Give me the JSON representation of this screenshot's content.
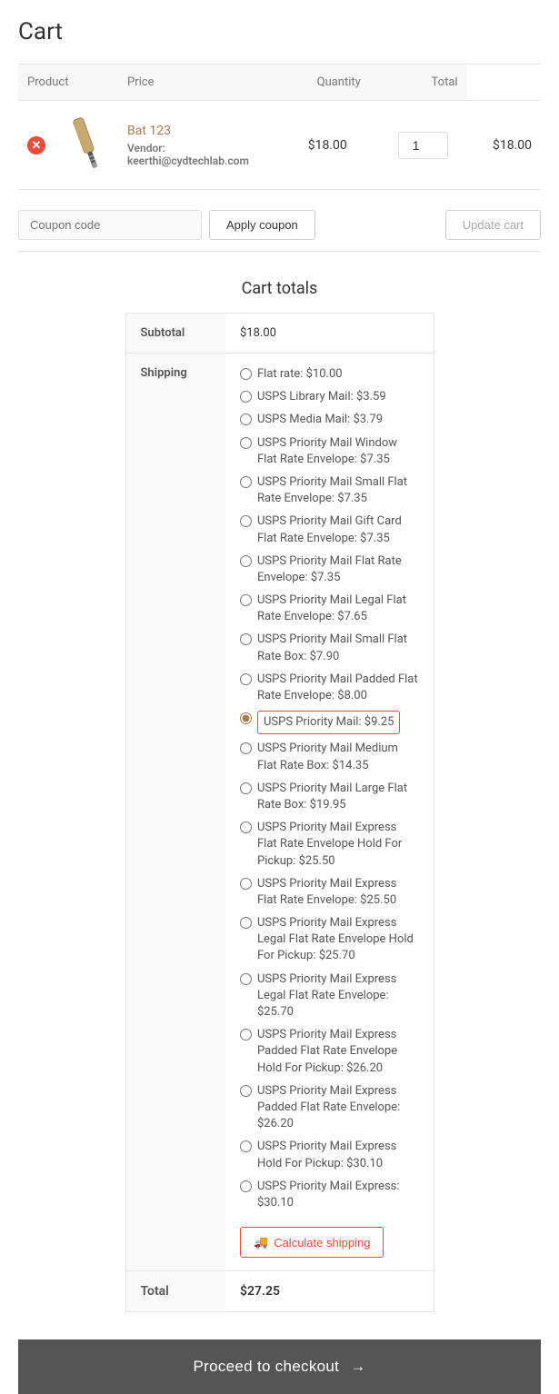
{
  "page": {
    "title": "Cart"
  },
  "table": {
    "headers": {
      "product": "Product",
      "price": "Price",
      "quantity": "Quantity",
      "total": "Total"
    }
  },
  "cart_item": {
    "product_name": "Bat 123",
    "vendor_label": "Vendor:",
    "vendor_email": "keerthi@cydtechlab.com",
    "price": "$18.00",
    "quantity": 1,
    "total": "$18.00"
  },
  "coupon": {
    "placeholder": "Coupon code",
    "apply_label": "Apply coupon",
    "update_label": "Update cart"
  },
  "cart_totals": {
    "title": "Cart totals",
    "subtotal_label": "Subtotal",
    "subtotal_value": "$18.00",
    "shipping_label": "Shipping",
    "total_label": "Total",
    "total_value": "$27.25"
  },
  "shipping_options": [
    {
      "id": "opt1",
      "label": "Flat rate: $10.00",
      "selected": false
    },
    {
      "id": "opt2",
      "label": "USPS Library Mail: $3.59",
      "selected": false
    },
    {
      "id": "opt3",
      "label": "USPS Media Mail: $3.79",
      "selected": false
    },
    {
      "id": "opt4",
      "label": "USPS Priority Mail Window Flat Rate Envelope: $7.35",
      "selected": false
    },
    {
      "id": "opt5",
      "label": "USPS Priority Mail Small Flat Rate Envelope: $7.35",
      "selected": false
    },
    {
      "id": "opt6",
      "label": "USPS Priority Mail Gift Card Flat Rate Envelope: $7.35",
      "selected": false
    },
    {
      "id": "opt7",
      "label": "USPS Priority Mail Flat Rate Envelope: $7.35",
      "selected": false
    },
    {
      "id": "opt8",
      "label": "USPS Priority Mail Legal Flat Rate Envelope: $7.65",
      "selected": false
    },
    {
      "id": "opt9",
      "label": "USPS Priority Mail Small Flat Rate Box: $7.90",
      "selected": false
    },
    {
      "id": "opt10",
      "label": "USPS Priority Mail Padded Flat Rate Envelope: $8.00",
      "selected": false
    },
    {
      "id": "opt11",
      "label": "USPS Priority Mail: $9.25",
      "selected": true
    },
    {
      "id": "opt12",
      "label": "USPS Priority Mail Medium Flat Rate Box: $14.35",
      "selected": false
    },
    {
      "id": "opt13",
      "label": "USPS Priority Mail Large Flat Rate Box: $19.95",
      "selected": false
    },
    {
      "id": "opt14",
      "label": "USPS Priority Mail Express Flat Rate Envelope Hold For Pickup: $25.50",
      "selected": false
    },
    {
      "id": "opt15",
      "label": "USPS Priority Mail Express Flat Rate Envelope: $25.50",
      "selected": false
    },
    {
      "id": "opt16",
      "label": "USPS Priority Mail Express Legal Flat Rate Envelope Hold For Pickup: $25.70",
      "selected": false
    },
    {
      "id": "opt17",
      "label": "USPS Priority Mail Express Legal Flat Rate Envelope: $25.70",
      "selected": false
    },
    {
      "id": "opt18",
      "label": "USPS Priority Mail Express Padded Flat Rate Envelope Hold For Pickup: $26.20",
      "selected": false
    },
    {
      "id": "opt19",
      "label": "USPS Priority Mail Express Padded Flat Rate Envelope: $26.20",
      "selected": false
    },
    {
      "id": "opt20",
      "label": "USPS Priority Mail Express Hold For Pickup: $30.10",
      "selected": false
    },
    {
      "id": "opt21",
      "label": "USPS Priority Mail Express: $30.10",
      "selected": false
    }
  ],
  "calculate_shipping": {
    "label": "Calculate shipping"
  },
  "checkout": {
    "label": "Proceed to checkout",
    "arrow": "→"
  },
  "colors": {
    "accent": "#a67c52",
    "danger": "#e74c3c",
    "checkout_bg": "#555555"
  }
}
